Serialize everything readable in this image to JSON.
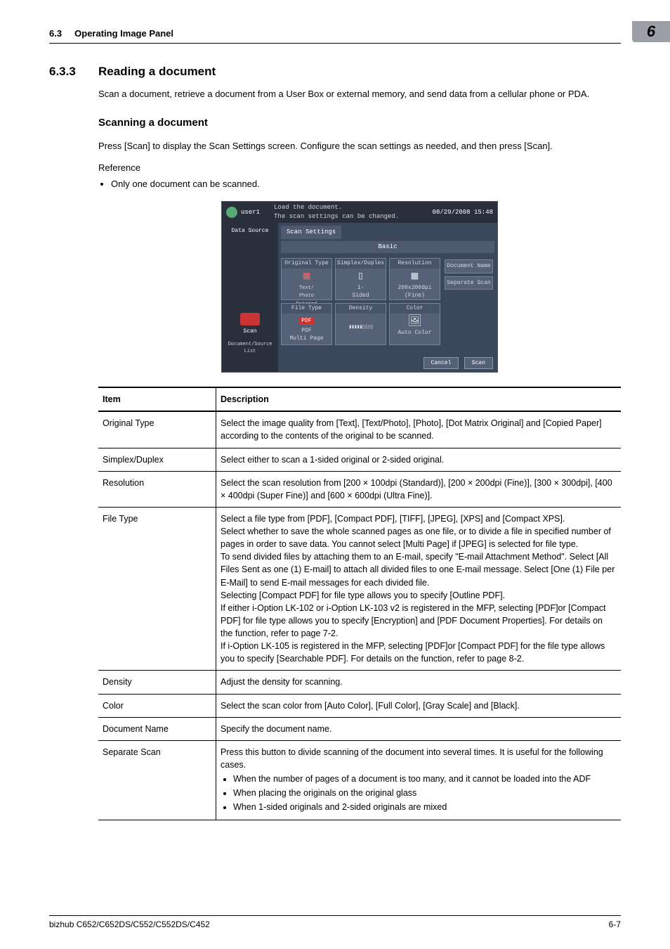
{
  "page": {
    "header_section": "6.3",
    "header_title": "Operating Image Panel",
    "chapter_badge": "6",
    "footer_model": "bizhub C652/C652DS/C552/C552DS/C452",
    "footer_page": "6-7"
  },
  "section": {
    "number": "6.3.3",
    "title": "Reading a document",
    "intro": "Scan a document, retrieve a document from a User Box or external memory, and send data from a cellular phone or PDA.",
    "sub_title": "Scanning a document",
    "sub_intro": "Press [Scan] to display the Scan Settings screen. Configure the scan settings as needed, and then press [Scan].",
    "reference_label": "Reference",
    "reference_item": "Only one document can be scanned."
  },
  "mfp": {
    "user": "user1",
    "msg1": "Load the document.",
    "msg2": "The scan settings can be changed.",
    "datetime": "08/29/2008  15:48",
    "data_source": "Data Source",
    "scan_side": "Scan",
    "doc_src": "Document/Source List",
    "tab": "Scan Settings",
    "basic": "Basic",
    "tiles": {
      "t1": {
        "h": "Original Type",
        "v": "Text/\nPhoto\nPrinted\nPhoto"
      },
      "t2": {
        "h": "Simplex/Duplex",
        "v": "1-\nSided"
      },
      "t3": {
        "h": "Resolution",
        "v": "200x200dpi\n(Fine)"
      },
      "docname": "Document Name",
      "sepscan": "Separate Scan",
      "t5": {
        "h": "File Type",
        "v": "PDF\nMulti Page"
      },
      "t6": {
        "h": "Density",
        "v": "▮▮▮▮▮▯▯▯▯"
      },
      "t7": {
        "h": "Color",
        "v": "Auto Color"
      }
    },
    "cancel": "Cancel",
    "scan": "Scan"
  },
  "table": {
    "head_item": "Item",
    "head_desc": "Description",
    "rows": {
      "r1": {
        "k": "Original Type",
        "v": "Select the image quality from [Text], [Text/Photo], [Photo], [Dot Matrix Original] and [Copied Paper] according to the contents of the original to be scanned."
      },
      "r2": {
        "k": "Simplex/Duplex",
        "v": "Select either to scan a 1-sided original or 2-sided original."
      },
      "r3": {
        "k": "Resolution",
        "v": "Select the scan resolution from [200 × 100dpi (Standard)], [200 × 200dpi (Fine)], [300 × 300dpi], [400 × 400dpi (Super Fine)] and [600 × 600dpi (Ultra Fine)]."
      },
      "r4": {
        "k": "File Type",
        "v": "Select a file type from [PDF], [Compact PDF], [TIFF], [JPEG], [XPS] and [Compact XPS].\nSelect whether to save the whole scanned pages as one file, or to divide a file in specified number of pages in order to save data. You cannot select [Multi Page] if [JPEG] is selected for file type.\nTo send divided files by attaching them to an E-mail, specify \"E-mail Attachment Method\". Select [All Files Sent as one (1) E-mail] to attach all divided files to one E-mail message. Select [One (1) File per E-Mail] to send E-mail messages for each divided file.\nSelecting [Compact PDF] for file type allows you to specify [Outline PDF].\nIf either i-Option LK-102 or i-Option LK-103 v2 is registered in the MFP, selecting [PDF]or [Compact PDF] for file type allows you to specify [Encryption] and [PDF Document Properties]. For details on the function, refer to page 7-2.\nIf i-Option LK-105 is registered in the MFP, selecting [PDF]or [Compact PDF] for the file type allows you to specify [Searchable PDF]. For details on the function, refer to page 8-2."
      },
      "r5": {
        "k": "Density",
        "v": "Adjust the density for scanning."
      },
      "r6": {
        "k": "Color",
        "v": "Select the scan color from [Auto Color], [Full Color], [Gray Scale] and [Black]."
      },
      "r7": {
        "k": "Document Name",
        "v": "Specify the document name."
      },
      "r8": {
        "k": "Separate Scan",
        "v": "Press this button to divide scanning of the document into several times. It is useful for the following cases.",
        "b1": "When the number of pages of a document is too many, and it cannot be loaded into the ADF",
        "b2": "When placing the originals on the original glass",
        "b3": "When 1-sided originals and 2-sided originals are mixed"
      }
    }
  }
}
